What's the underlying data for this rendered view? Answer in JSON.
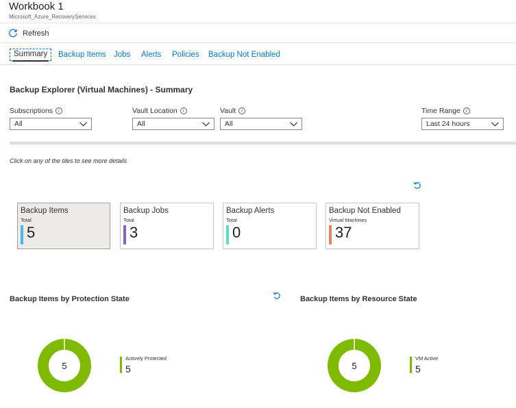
{
  "header": {
    "title": "Workbook 1",
    "subtitle": "Microsoft_Azure_RecoveryServices"
  },
  "toolbar": {
    "refresh_label": "Refresh",
    "refresh_icon": "refresh-icon"
  },
  "tabs": [
    {
      "label": "Summary",
      "active": true
    },
    {
      "label": "Backup Items",
      "active": false
    },
    {
      "label": "Jobs",
      "active": false
    },
    {
      "label": "Alerts",
      "active": false
    },
    {
      "label": "Policies",
      "active": false
    },
    {
      "label": "Backup Not Enabled",
      "active": false
    }
  ],
  "section": {
    "title": "Backup Explorer (Virtual Machines) - Summary",
    "hint": "Click on any of the tiles to see more details"
  },
  "params": {
    "subscriptions": {
      "label": "Subscriptions",
      "value": "All"
    },
    "vault_location": {
      "label": "Vault Location",
      "value": "All"
    },
    "vault": {
      "label": "Vault",
      "value": "All"
    },
    "time_range": {
      "label": "Time Range",
      "value": "Last 24 hours"
    },
    "info_glyph": "i"
  },
  "tiles": [
    {
      "title": "Backup Items",
      "subtitle": "Total",
      "value": "5",
      "color": "#4db8e8",
      "selected": true
    },
    {
      "title": "Backup Jobs",
      "subtitle": "Total",
      "value": "3",
      "color": "#8764b8",
      "selected": false
    },
    {
      "title": "Backup Alerts",
      "subtitle": "Total",
      "value": "0",
      "color": "#5ddbc5",
      "selected": false
    },
    {
      "title": "Backup Not Enabled",
      "subtitle": "Virtual Machines",
      "value": "37",
      "color": "#e8825c",
      "selected": false
    }
  ],
  "charts": {
    "protection_state": {
      "title": "Backup Items by Protection State",
      "total": "5",
      "legend_label": "Actively Protected",
      "legend_value": "5",
      "color": "#7fba00"
    },
    "resource_state": {
      "title": "Backup Items by Resource State",
      "total": "5",
      "legend_label": "VM Active",
      "legend_value": "5",
      "color": "#7fba00"
    }
  },
  "colors": {
    "accent": "#0078d4",
    "donut_green": "#7fba00"
  }
}
